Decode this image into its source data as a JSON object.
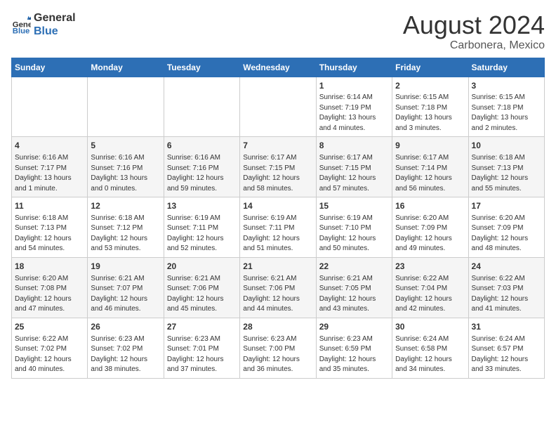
{
  "header": {
    "logo_line1": "General",
    "logo_line2": "Blue",
    "month": "August 2024",
    "location": "Carbonera, Mexico"
  },
  "days_of_week": [
    "Sunday",
    "Monday",
    "Tuesday",
    "Wednesday",
    "Thursday",
    "Friday",
    "Saturday"
  ],
  "weeks": [
    [
      {
        "day": "",
        "info": ""
      },
      {
        "day": "",
        "info": ""
      },
      {
        "day": "",
        "info": ""
      },
      {
        "day": "",
        "info": ""
      },
      {
        "day": "1",
        "info": "Sunrise: 6:14 AM\nSunset: 7:19 PM\nDaylight: 13 hours\nand 4 minutes."
      },
      {
        "day": "2",
        "info": "Sunrise: 6:15 AM\nSunset: 7:18 PM\nDaylight: 13 hours\nand 3 minutes."
      },
      {
        "day": "3",
        "info": "Sunrise: 6:15 AM\nSunset: 7:18 PM\nDaylight: 13 hours\nand 2 minutes."
      }
    ],
    [
      {
        "day": "4",
        "info": "Sunrise: 6:16 AM\nSunset: 7:17 PM\nDaylight: 13 hours\nand 1 minute."
      },
      {
        "day": "5",
        "info": "Sunrise: 6:16 AM\nSunset: 7:16 PM\nDaylight: 13 hours\nand 0 minutes."
      },
      {
        "day": "6",
        "info": "Sunrise: 6:16 AM\nSunset: 7:16 PM\nDaylight: 12 hours\nand 59 minutes."
      },
      {
        "day": "7",
        "info": "Sunrise: 6:17 AM\nSunset: 7:15 PM\nDaylight: 12 hours\nand 58 minutes."
      },
      {
        "day": "8",
        "info": "Sunrise: 6:17 AM\nSunset: 7:15 PM\nDaylight: 12 hours\nand 57 minutes."
      },
      {
        "day": "9",
        "info": "Sunrise: 6:17 AM\nSunset: 7:14 PM\nDaylight: 12 hours\nand 56 minutes."
      },
      {
        "day": "10",
        "info": "Sunrise: 6:18 AM\nSunset: 7:13 PM\nDaylight: 12 hours\nand 55 minutes."
      }
    ],
    [
      {
        "day": "11",
        "info": "Sunrise: 6:18 AM\nSunset: 7:13 PM\nDaylight: 12 hours\nand 54 minutes."
      },
      {
        "day": "12",
        "info": "Sunrise: 6:18 AM\nSunset: 7:12 PM\nDaylight: 12 hours\nand 53 minutes."
      },
      {
        "day": "13",
        "info": "Sunrise: 6:19 AM\nSunset: 7:11 PM\nDaylight: 12 hours\nand 52 minutes."
      },
      {
        "day": "14",
        "info": "Sunrise: 6:19 AM\nSunset: 7:11 PM\nDaylight: 12 hours\nand 51 minutes."
      },
      {
        "day": "15",
        "info": "Sunrise: 6:19 AM\nSunset: 7:10 PM\nDaylight: 12 hours\nand 50 minutes."
      },
      {
        "day": "16",
        "info": "Sunrise: 6:20 AM\nSunset: 7:09 PM\nDaylight: 12 hours\nand 49 minutes."
      },
      {
        "day": "17",
        "info": "Sunrise: 6:20 AM\nSunset: 7:09 PM\nDaylight: 12 hours\nand 48 minutes."
      }
    ],
    [
      {
        "day": "18",
        "info": "Sunrise: 6:20 AM\nSunset: 7:08 PM\nDaylight: 12 hours\nand 47 minutes."
      },
      {
        "day": "19",
        "info": "Sunrise: 6:21 AM\nSunset: 7:07 PM\nDaylight: 12 hours\nand 46 minutes."
      },
      {
        "day": "20",
        "info": "Sunrise: 6:21 AM\nSunset: 7:06 PM\nDaylight: 12 hours\nand 45 minutes."
      },
      {
        "day": "21",
        "info": "Sunrise: 6:21 AM\nSunset: 7:06 PM\nDaylight: 12 hours\nand 44 minutes."
      },
      {
        "day": "22",
        "info": "Sunrise: 6:21 AM\nSunset: 7:05 PM\nDaylight: 12 hours\nand 43 minutes."
      },
      {
        "day": "23",
        "info": "Sunrise: 6:22 AM\nSunset: 7:04 PM\nDaylight: 12 hours\nand 42 minutes."
      },
      {
        "day": "24",
        "info": "Sunrise: 6:22 AM\nSunset: 7:03 PM\nDaylight: 12 hours\nand 41 minutes."
      }
    ],
    [
      {
        "day": "25",
        "info": "Sunrise: 6:22 AM\nSunset: 7:02 PM\nDaylight: 12 hours\nand 40 minutes."
      },
      {
        "day": "26",
        "info": "Sunrise: 6:23 AM\nSunset: 7:02 PM\nDaylight: 12 hours\nand 38 minutes."
      },
      {
        "day": "27",
        "info": "Sunrise: 6:23 AM\nSunset: 7:01 PM\nDaylight: 12 hours\nand 37 minutes."
      },
      {
        "day": "28",
        "info": "Sunrise: 6:23 AM\nSunset: 7:00 PM\nDaylight: 12 hours\nand 36 minutes."
      },
      {
        "day": "29",
        "info": "Sunrise: 6:23 AM\nSunset: 6:59 PM\nDaylight: 12 hours\nand 35 minutes."
      },
      {
        "day": "30",
        "info": "Sunrise: 6:24 AM\nSunset: 6:58 PM\nDaylight: 12 hours\nand 34 minutes."
      },
      {
        "day": "31",
        "info": "Sunrise: 6:24 AM\nSunset: 6:57 PM\nDaylight: 12 hours\nand 33 minutes."
      }
    ]
  ]
}
